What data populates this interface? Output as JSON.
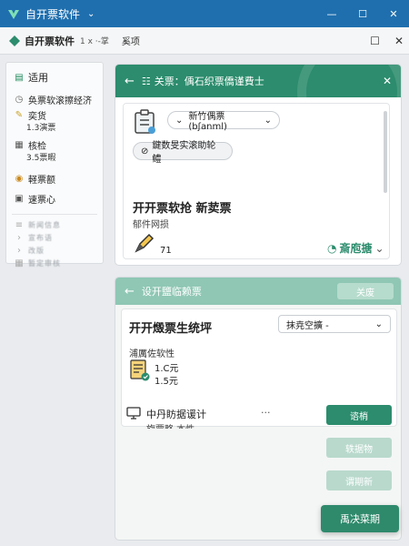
{
  "titlebar": {
    "title": "自开票软件",
    "chevron": "⌄",
    "minimize": "—",
    "maximize": "☐",
    "close": "✕"
  },
  "tabbar": {
    "name": "自开票软件",
    "sub": "1 x ·-掌",
    "section": "奚项",
    "restore": "☐",
    "close": "✕"
  },
  "sidebar": {
    "header": "适用",
    "items": [
      {
        "label": "奂票软滚擦经济",
        "icon": "clock-icon"
      },
      {
        "label": "奕货",
        "sub": "1.3演票",
        "icon": "pencil-icon"
      },
      {
        "label": "核检",
        "sub": "3.5票暇",
        "icon": "doc-icon"
      },
      {
        "label": "軽票额",
        "icon": "coins-icon"
      },
      {
        "label": "速票心",
        "icon": "box-icon"
      }
    ],
    "blurred": [
      "新闻信息",
      "宣布语",
      "改版",
      "暂定审核"
    ]
  },
  "card1": {
    "header_title": "关票：偊石织票僑谨費士",
    "select_value": "新竹偶票 (bʃanml)",
    "pill_label": "鍵数旻实滚助轮鳢",
    "main_title": "开开票软抢 新荬票",
    "subtitle": "郁件网损",
    "count": "71",
    "action_label": "斎庖搪"
  },
  "card2": {
    "header_title": "设开鹽临赖票",
    "header_button": "关废",
    "main_title": "开开燬票生统坪",
    "dropdown_value": "抹尭空擴 -",
    "row_label": "浦厲佐软性",
    "amount1": "1.C元",
    "amount2": "1.5元",
    "item_title": "中丹眆据谖计",
    "item_sub": "旋票略 本性",
    "more": "···",
    "btn_primary": "谘梢",
    "btn_secondary1": "轶据物",
    "btn_secondary2": "谓期新"
  },
  "fab_label": "禹决菜期",
  "colors": {
    "titlebar": "#1f6fae",
    "accent": "#2c8c6d",
    "accent_pale": "#8fc7b4"
  }
}
